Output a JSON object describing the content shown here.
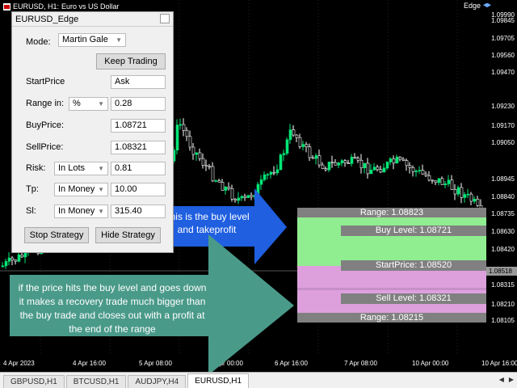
{
  "chart_header": {
    "symbol": "EURUSD, H1:",
    "description": "Euro vs US Dollar",
    "ea_name": "Edge",
    "icons": [
      "chart-window-icon",
      "graduation-cap-icon"
    ]
  },
  "price_axis": {
    "labels": [
      "1.09990",
      "1.09845",
      "1.09705",
      "1.09560",
      "1.09470",
      "1.09230",
      "1.09170",
      "1.09050",
      "1.08945",
      "1.08840",
      "1.08735",
      "1.08630",
      "1.08420",
      "1.08315",
      "1.08210",
      "1.08105"
    ],
    "current_price": "1.08518"
  },
  "time_axis": {
    "labels": [
      "4 Apr 2023",
      "4 Apr 16:00",
      "5 Apr 08:00",
      "6 Apr 00:00",
      "6 Apr 16:00",
      "7 Apr 08:00",
      "10 Apr 00:00",
      "10 Apr 16:00"
    ]
  },
  "tabs": [
    "GBPUSD,H1",
    "BTCUSD,H1",
    "AUDJPY,H4",
    "EURUSD,H1"
  ],
  "active_tab": "EURUSD,H1",
  "panel": {
    "title": "EURUSD_Edge",
    "mode_label": "Mode:",
    "mode_value": "Martin Gale",
    "keep_trading": "Keep Trading",
    "start_price_label": "StartPrice",
    "start_price_value": "Ask",
    "range_label": "Range in:",
    "range_unit": "%",
    "range_value": "0.28",
    "buy_price_label": "BuyPrice:",
    "buy_price_value": "1.08721",
    "sell_price_label": "SellPrice:",
    "sell_price_value": "1.08321",
    "risk_label": "Risk:",
    "risk_unit": "In Lots",
    "risk_value": "0.81",
    "tp_label": "Tp:",
    "tp_unit": "In Money",
    "tp_value": "10.00",
    "sl_label": "Sl:",
    "sl_unit": "In Money",
    "sl_value": "315.40",
    "stop_strategy": "Stop Strategy",
    "hide_strategy": "Hide Strategy"
  },
  "annotations": {
    "buy_note": "This is the buy level and takeprofit",
    "recovery_note": "if the price hits the buy level and goes down it makes a recovery trade much bigger than the buy trade and closes out with a profit at the end of the range"
  },
  "levels": {
    "range_top": "Range: 1.08823",
    "buy_level": "Buy Level: 1.08721",
    "start_price": "StartPrice: 1.08520",
    "sell_level": "Sell Level: 1.08321",
    "range_bottom": "Range: 1.08215"
  },
  "colors": {
    "background": "#000000",
    "bull_candle": "#00e676",
    "bear_candle": "#ffffff",
    "buy_zone": "#90ee90",
    "sell_zone": "#dda0dd",
    "level_bar": "#808080",
    "blue_arrow": "#1f5fe0",
    "teal_arrow": "#4a9a8a"
  }
}
